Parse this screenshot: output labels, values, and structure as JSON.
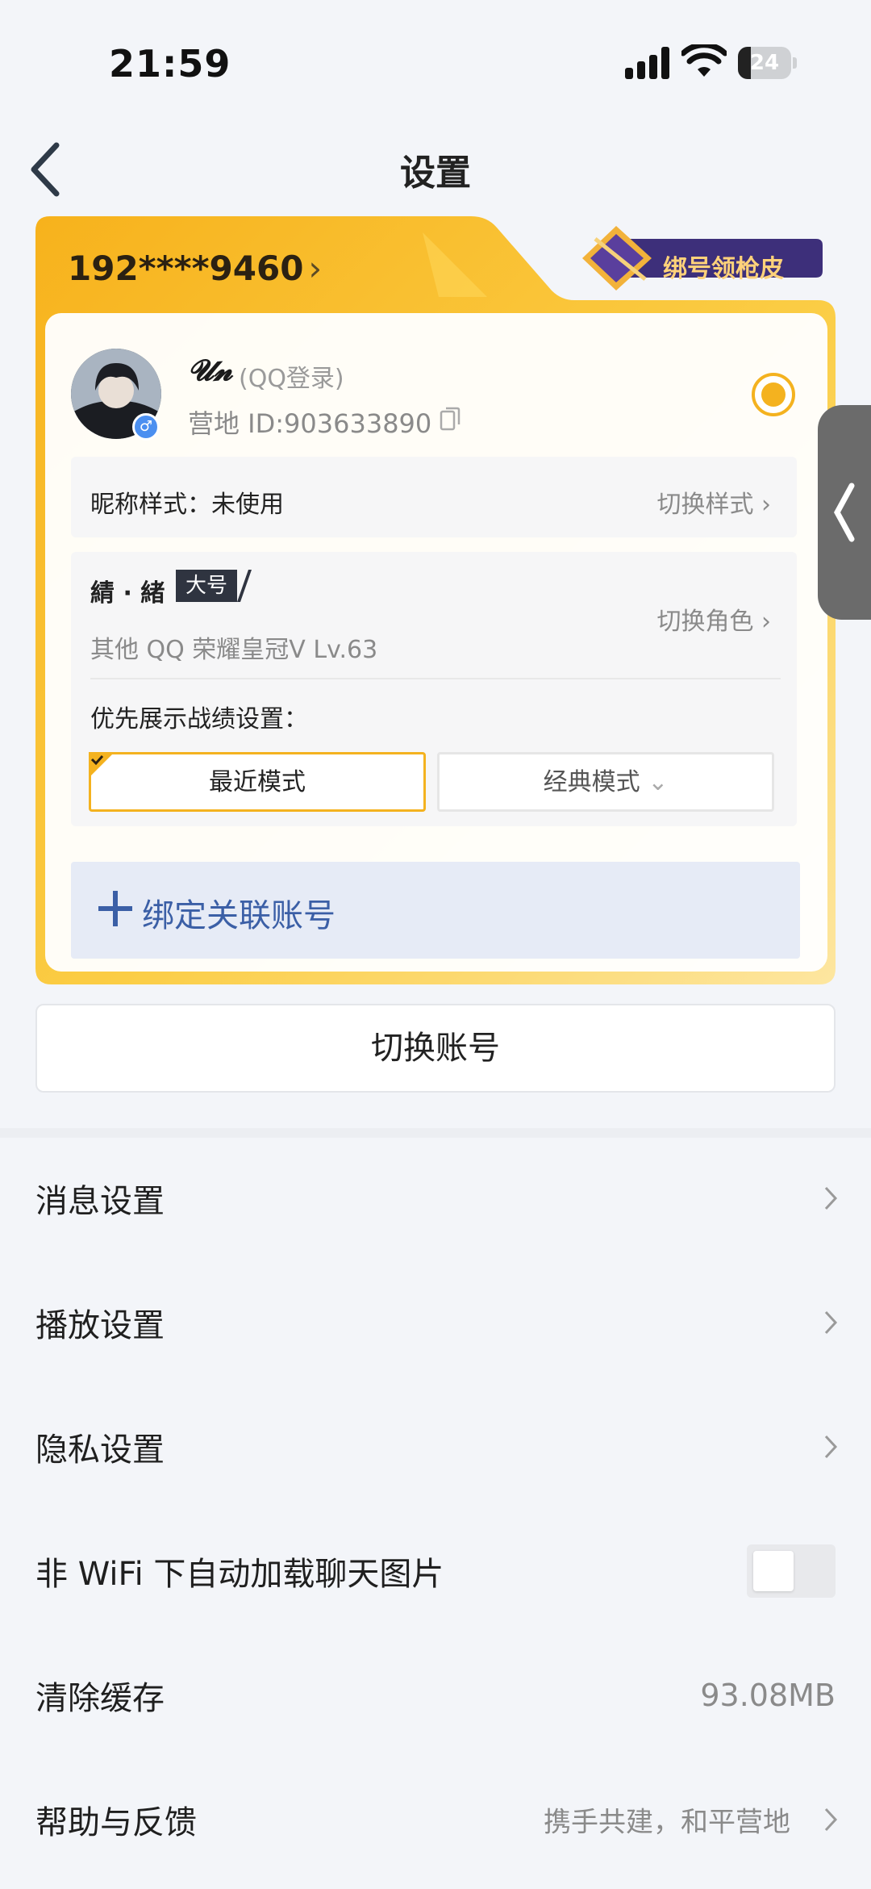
{
  "status_bar": {
    "time": "21:59",
    "battery": "24",
    "battery_level": 0.24
  },
  "nav": {
    "title": "设置"
  },
  "account_card": {
    "phone": "192****9460",
    "promo_label": "绑号领枪皮",
    "nickname": "𝓤𝓷",
    "login_type": "(QQ登录)",
    "camp_id": "营地 ID:903633890",
    "nick_style_label": "昵称样式：未使用",
    "nick_style_action": "切换样式",
    "role_name": "綪 · 緒",
    "role_tag": "大号",
    "role_sub": "其他 QQ  荣耀皇冠Ⅴ  Lv.63",
    "switch_role": "切换角色",
    "priority_label": "优先展示战绩设置：",
    "mode_recent": "最近模式",
    "mode_classic": "经典模式",
    "bind_label": "绑定关联账号"
  },
  "switch_account": "切换账号",
  "menu": {
    "message_settings": "消息设置",
    "playback_settings": "播放设置",
    "privacy_settings": "隐私设置",
    "wifi_images": "非 WiFi 下自动加载聊天图片",
    "clear_cache": "清除缓存",
    "cache_size": "93.08MB",
    "help_feedback": "帮助与反馈",
    "help_value": "携手共建，和平营地"
  },
  "colors": {
    "accent": "#f4b21f",
    "bind_blue": "#3b5fa6"
  }
}
